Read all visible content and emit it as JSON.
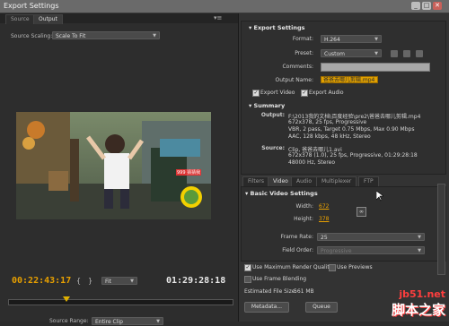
{
  "window": {
    "title": "Export Settings"
  },
  "left": {
    "tabs": [
      "Source",
      "Output"
    ],
    "source_scaling_label": "Source Scaling:",
    "source_scaling_value": "Scale To Fit",
    "video_overlay": "999 猜猜我",
    "time_current": "00:22:43:17",
    "time_total": "01:29:28:18",
    "fit_select": "Fit",
    "source_range_label": "Source Range:",
    "source_range_value": "Entire Clip"
  },
  "export": {
    "section_title": "Export Settings",
    "format_label": "Format:",
    "format_value": "H.264",
    "preset_label": "Preset:",
    "preset_value": "Custom",
    "comments_label": "Comments:",
    "output_name_label": "Output Name:",
    "output_name_value": "爸爸去哪儿剪辑.mp4",
    "export_video_label": "Export Video",
    "export_audio_label": "Export Audio"
  },
  "summary": {
    "section_title": "Summary",
    "output_label": "Output:",
    "output_lines": [
      "F:\\2013我的文档\\百度经验\\pre2\\爸爸去哪儿剪辑.mp4",
      "672x378, 25 fps, Progressive",
      "VBR, 2 pass, Target 0.75 Mbps, Max 0.90 Mbps",
      "AAC, 128 kbps, 48 kHz, Stereo"
    ],
    "source_label": "Source:",
    "source_lines": [
      "Clip, 爸爸去哪儿1.avi",
      "672x378 (1.0), 25 fps, Progressive, 01:29:28:18",
      "48000 Hz, Stereo"
    ]
  },
  "tabs": [
    "Filters",
    "Video",
    "Audio",
    "Multiplexer",
    "FTP"
  ],
  "basic_video": {
    "section_title": "Basic Video Settings",
    "width_label": "Width:",
    "width_value": "672",
    "height_label": "Height:",
    "height_value": "378",
    "frame_rate_label": "Frame Rate:",
    "frame_rate_value": "25",
    "field_order_label": "Field Order:",
    "field_order_value": "Progressive"
  },
  "options": {
    "max_render_quality": "Use Maximum Render Quality",
    "use_previews": "Use Previews",
    "frame_blending": "Use Frame Blending",
    "file_size_label": "Estimated File Size:",
    "file_size_value": "561 MB",
    "metadata_button": "Metadata...",
    "queue_button": "Queue"
  },
  "watermark": {
    "line1": "jb51.net",
    "line2": "脚本之家"
  },
  "colors": {
    "accent": "#e8a000",
    "panel": "#2f2f2f"
  }
}
